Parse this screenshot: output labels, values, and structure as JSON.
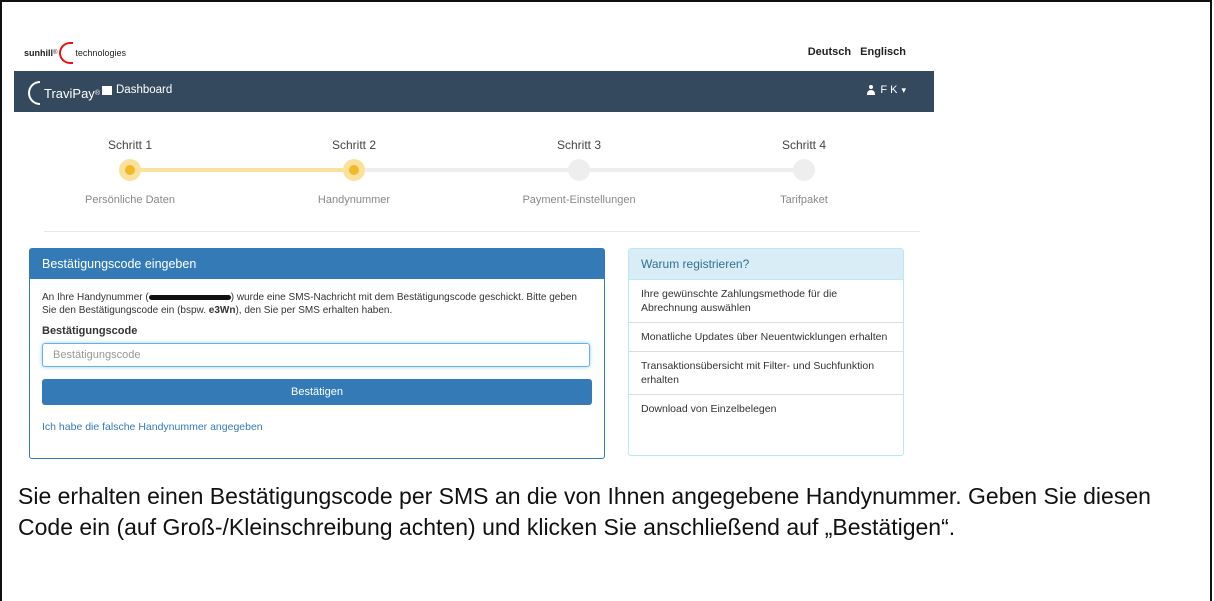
{
  "header": {
    "logo_brand": "sunhill",
    "logo_reg": "®",
    "logo_suffix": "technologies",
    "lang_de": "Deutsch",
    "lang_en": "Englisch"
  },
  "navbar": {
    "brand": "TraviPay",
    "brand_reg": "®",
    "dashboard": "Dashboard",
    "user": "F K",
    "user_caret": "▾"
  },
  "stepper": {
    "steps": [
      {
        "label": "Schritt 1",
        "sub": "Persönliche Daten",
        "state": "done"
      },
      {
        "label": "Schritt 2",
        "sub": "Handynummer",
        "state": "active"
      },
      {
        "label": "Schritt 3",
        "sub": "Payment-Einstellungen",
        "state": "idle"
      },
      {
        "label": "Schritt 4",
        "sub": "Tarifpaket",
        "state": "idle"
      }
    ],
    "active_color": "#f1b82a",
    "track_active_color": "#fbe29a",
    "track_idle_color": "#eeeeee"
  },
  "confirm": {
    "title": "Bestätigungscode eingeben",
    "text_1": "An Ihre Handynummer (",
    "text_2": ") wurde eine SMS-Nachricht mit dem Bestätigungscode geschickt. Bitte geben Sie den Bestätigungscode ein (bspw. ",
    "example_code": "e3Wn",
    "text_3": "), den Sie per SMS erhalten haben.",
    "field_label": "Bestätigungscode",
    "placeholder": "Bestätigungscode",
    "button": "Bestätigen",
    "wrong_number_link": "Ich habe die falsche Handynummer angegeben"
  },
  "why": {
    "title": "Warum registrieren?",
    "items": [
      "Ihre gewünschte Zahlungsmethode für die Abrechnung auswählen",
      "Monatliche Updates über Neuentwicklungen erhalten",
      "Transaktionsübersicht mit Filter- und Suchfunktion erhalten",
      "Download von Einzelbelegen"
    ]
  },
  "caption": "Sie erhalten einen Bestätigungscode per SMS an die von Ihnen angegebene Handynummer. Geben Sie diesen Code ein (auf Groß-/Kleinschreibung achten) und klicken Sie anschließend auf „Bestätigen“.",
  "colors": {
    "navbar": "#35495e",
    "primary": "#337ab7",
    "info_bg": "#d9edf7",
    "info_text": "#31708f"
  }
}
